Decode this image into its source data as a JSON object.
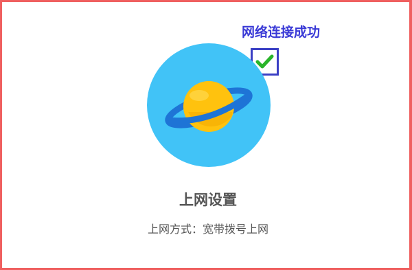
{
  "connection": {
    "status_text": "网络连接成功",
    "status_checked": true
  },
  "icon": {
    "name": "planet-icon",
    "background_color": "#41c3f7",
    "planet_color": "#ffc20e",
    "ring_color": "#1e74d6"
  },
  "section": {
    "title": "上网设置",
    "mode_line": "上网方式：宽带拨号上网"
  },
  "colors": {
    "frame_border": "#ef6060",
    "status_text": "#3a3ad6",
    "check_mark": "#2ab52a",
    "text": "#555555"
  }
}
